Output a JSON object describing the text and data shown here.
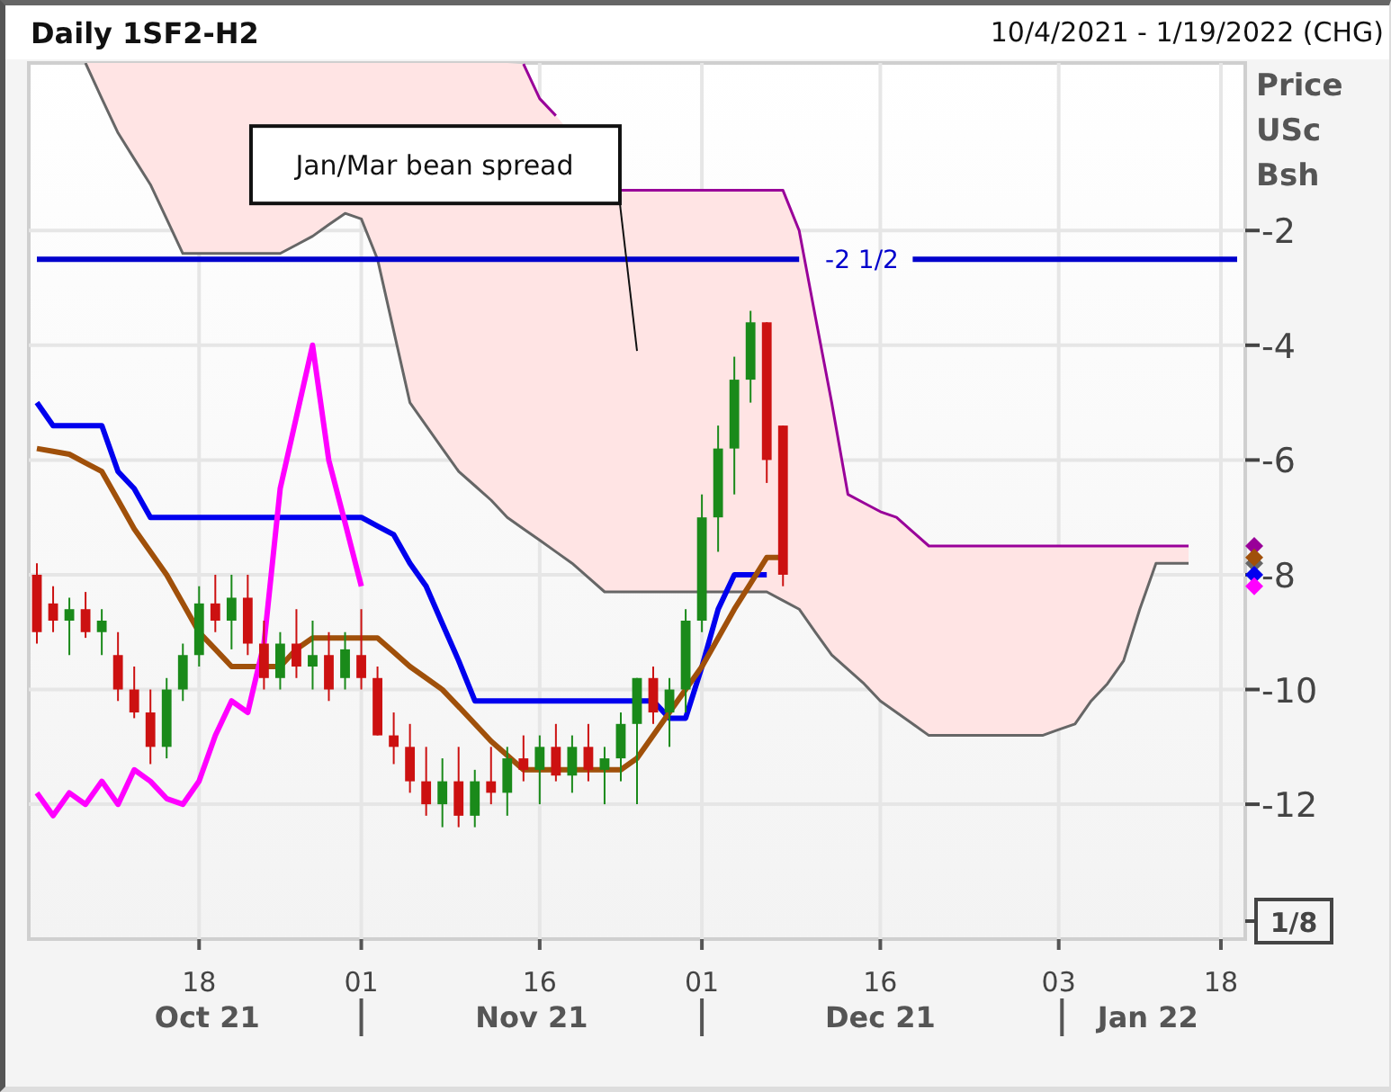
{
  "header": {
    "title": "Daily 1SF2-H2",
    "date_range": "10/4/2021 - 1/19/2022 (CHG)"
  },
  "price_scale": {
    "title_lines": [
      "Price",
      "USc",
      "Bsh"
    ],
    "fraction": "1/8"
  },
  "month_axis": [
    {
      "label": "Oct 21"
    },
    {
      "label": "Nov 21"
    },
    {
      "label": "Dec 21"
    },
    {
      "label": "Jan 22"
    }
  ],
  "chart": {
    "chart_data": {
      "type": "line",
      "ylim": [
        -14.35,
        0.92
      ],
      "grid": true,
      "yticks": [
        -2,
        -4,
        -6,
        -8,
        -10,
        -12
      ],
      "categories": [
        null,
        null,
        null,
        null,
        null,
        null,
        null,
        null,
        null,
        null,
        "18",
        null,
        null,
        null,
        null,
        null,
        null,
        null,
        null,
        null,
        "01",
        null,
        null,
        null,
        null,
        null,
        null,
        null,
        null,
        null,
        null,
        "16",
        null,
        null,
        null,
        null,
        null,
        null,
        null,
        null,
        null,
        "01",
        null,
        null,
        null,
        null,
        null,
        null,
        null,
        null,
        null,
        null,
        "16",
        null,
        null,
        null,
        null,
        null,
        null,
        null,
        null,
        null,
        null,
        "03",
        null,
        null,
        null,
        null,
        null,
        null,
        null,
        null,
        null,
        "18",
        null
      ],
      "series": [
        {
          "color": "#990099",
          "values": [
            null,
            null,
            null,
            null,
            null,
            null,
            null,
            null,
            null,
            null,
            null,
            null,
            null,
            null,
            null,
            null,
            null,
            null,
            null,
            null,
            null,
            null,
            null,
            null,
            null,
            null,
            null,
            null,
            null,
            null,
            0.9,
            0.3,
            0.0,
            null,
            null,
            null,
            -1.3,
            -1.3,
            -1.3,
            -1.3,
            -1.3,
            -1.3,
            -1.3,
            -1.3,
            -1.3,
            -1.3,
            -1.3,
            -2.0,
            -3.5,
            -5.0,
            -6.6,
            -6.75,
            -6.9,
            -7.0,
            -7.25,
            -7.5,
            -7.5,
            -7.5,
            -7.5,
            -7.5,
            -7.5,
            -7.5,
            -7.5,
            -7.5,
            -7.5,
            -7.5,
            -7.5,
            -7.5,
            -7.5,
            -7.5,
            -7.5,
            -7.5,
            null,
            null,
            null
          ]
        },
        {
          "color": "#666666",
          "values": [
            null,
            null,
            null,
            0.92,
            0.3,
            -0.3,
            -0.75,
            -1.2,
            -1.8,
            -2.4,
            -2.4,
            -2.4,
            -2.4,
            -2.4,
            -2.4,
            -2.4,
            -2.25,
            -2.1,
            -1.9,
            -1.7,
            -1.8,
            -2.5,
            -3.75,
            -5.0,
            -5.4,
            -5.8,
            -6.2,
            -6.45,
            -6.7,
            -7.0,
            -7.2,
            -7.4,
            -7.6,
            -7.8,
            -8.05,
            -8.3,
            -8.3,
            -8.3,
            -8.3,
            -8.3,
            -8.3,
            -8.3,
            -8.3,
            -8.3,
            -8.3,
            -8.3,
            -8.45,
            -8.6,
            -9.0,
            -9.4,
            -9.65,
            -9.9,
            -10.2,
            -10.4,
            -10.6,
            -10.8,
            -10.8,
            -10.8,
            -10.8,
            -10.8,
            -10.8,
            -10.8,
            -10.8,
            -10.7,
            -10.6,
            -10.2,
            -9.9,
            -9.5,
            -8.6,
            -7.8,
            -7.8,
            -7.8,
            null,
            null,
            null
          ]
        },
        {
          "color": "#0000ee",
          "values": [
            -5.0,
            -5.4,
            -5.4,
            -5.4,
            -5.4,
            -6.2,
            -6.5,
            -7.0,
            -7.0,
            -7.0,
            -7.0,
            -7.0,
            -7.0,
            -7.0,
            -7.0,
            -7.0,
            -7.0,
            -7.0,
            -7.0,
            -7.0,
            -7.0,
            -7.15,
            -7.3,
            -7.8,
            -8.2,
            -8.85,
            -9.5,
            -10.2,
            -10.2,
            -10.2,
            -10.2,
            -10.2,
            -10.2,
            -10.2,
            -10.2,
            -10.2,
            -10.2,
            -10.2,
            -10.2,
            -10.5,
            -10.5,
            -9.6,
            -8.6,
            -8.0,
            -8.0,
            -8.0,
            null,
            null,
            null,
            null,
            null,
            null,
            null,
            null,
            null,
            null,
            null,
            null,
            null,
            null,
            null,
            null,
            null,
            null,
            null,
            null,
            null,
            null,
            null,
            null,
            null,
            null,
            null,
            null,
            null
          ]
        },
        {
          "color": "#a0500a",
          "values": [
            -5.8,
            -5.85,
            -5.9,
            -6.05,
            -6.2,
            -6.7,
            -7.2,
            -7.6,
            -8.0,
            -8.5,
            -9.0,
            -9.3,
            -9.6,
            -9.6,
            -9.6,
            -9.6,
            -9.3,
            -9.1,
            -9.1,
            -9.1,
            -9.1,
            -9.1,
            -9.35,
            -9.6,
            -9.8,
            -10.0,
            -10.3,
            -10.6,
            -10.9,
            -11.15,
            -11.4,
            -11.4,
            -11.4,
            -11.4,
            -11.4,
            -11.4,
            -11.4,
            -11.2,
            -10.8,
            -10.4,
            -10.0,
            -9.6,
            -9.1,
            -8.6,
            -8.15,
            -7.7,
            -7.7,
            null,
            null,
            null,
            null,
            null,
            null,
            null,
            null,
            null,
            null,
            null,
            null,
            null,
            null,
            null,
            null,
            null,
            null,
            null,
            null,
            null,
            null,
            null,
            null,
            null,
            null,
            null,
            null
          ]
        },
        {
          "color": "#ff00ff",
          "values": [
            -11.8,
            -12.2,
            -11.8,
            -12.0,
            -11.6,
            -12.0,
            -11.4,
            -11.6,
            -11.9,
            -12.0,
            -11.6,
            -10.8,
            -10.2,
            -10.4,
            -9.2,
            -6.5,
            -5.25,
            -4.0,
            -6.0,
            -7.1,
            -8.2,
            null,
            null,
            null,
            null,
            null,
            null,
            null,
            null,
            null,
            null,
            null,
            null,
            null,
            null,
            null,
            null,
            null,
            null,
            null,
            null,
            null,
            null,
            null,
            null,
            null,
            null,
            null,
            null,
            null,
            null,
            null,
            null,
            null,
            null,
            null,
            null,
            null,
            null,
            null,
            null,
            null,
            null,
            null,
            null,
            null,
            null,
            null,
            null,
            null,
            null,
            null,
            null,
            null,
            null
          ]
        },
        {
          "name": "-2 1/2",
          "color": "#0000cc",
          "values": [
            -2.5,
            -2.5,
            -2.5,
            -2.5,
            -2.5,
            -2.5,
            -2.5,
            -2.5,
            -2.5,
            -2.5,
            -2.5,
            -2.5,
            -2.5,
            -2.5,
            -2.5,
            -2.5,
            -2.5,
            -2.5,
            -2.5,
            -2.5,
            -2.5,
            -2.5,
            -2.5,
            -2.5,
            -2.5,
            -2.5,
            -2.5,
            -2.5,
            -2.5,
            -2.5,
            -2.5,
            -2.5,
            -2.5,
            -2.5,
            -2.5,
            -2.5,
            -2.5,
            -2.5,
            -2.5,
            -2.5,
            -2.5,
            -2.5,
            -2.5,
            -2.5,
            -2.5,
            -2.5,
            -2.5,
            -2.5,
            null,
            null,
            null,
            null,
            null,
            null,
            -2.5,
            -2.5,
            -2.5,
            -2.5,
            -2.5,
            -2.5,
            -2.5,
            -2.5,
            -2.5,
            -2.5,
            -2.5,
            -2.5,
            -2.5,
            -2.5,
            -2.5,
            -2.5,
            -2.5,
            -2.5,
            -2.5,
            -2.5,
            -2.5
          ]
        }
      ],
      "annotations": [
        "Jan/Mar bean spread"
      ]
    }
  },
  "candles": {
    "chart_data": {
      "type": "candlestick",
      "ylim": [
        -14.35,
        0.92
      ],
      "ohlc": [
        [
          -8.0,
          -7.8,
          -9.2,
          -9.0
        ],
        [
          -8.5,
          -8.2,
          -9.0,
          -8.8
        ],
        [
          -8.8,
          -8.4,
          -9.4,
          -8.6
        ],
        [
          -8.6,
          -8.3,
          -9.1,
          -9.0
        ],
        [
          -9.0,
          -8.6,
          -9.4,
          -8.8
        ],
        [
          -9.4,
          -9.0,
          -10.2,
          -10.0
        ],
        [
          -10.0,
          -9.6,
          -10.5,
          -10.4
        ],
        [
          -10.4,
          -10.0,
          -11.3,
          -11.0
        ],
        [
          -11.0,
          -9.8,
          -11.2,
          -10.0
        ],
        [
          -10.0,
          -9.2,
          -10.2,
          -9.4
        ],
        [
          -9.4,
          -8.2,
          -9.6,
          -8.5
        ],
        [
          -8.5,
          -8.0,
          -9.0,
          -8.8
        ],
        [
          -8.8,
          -8.0,
          -9.3,
          -8.4
        ],
        [
          -8.4,
          -8.0,
          -9.4,
          -9.2
        ],
        [
          -9.2,
          -8.8,
          -10.0,
          -9.8
        ],
        [
          -9.8,
          -9.0,
          -10.0,
          -9.2
        ],
        [
          -9.2,
          -8.6,
          -9.8,
          -9.6
        ],
        [
          -9.6,
          -8.8,
          -10.0,
          -9.4
        ],
        [
          -9.4,
          -9.0,
          -10.2,
          -10.0
        ],
        [
          -9.8,
          -9.0,
          -10.0,
          -9.3
        ],
        [
          -9.4,
          -8.6,
          -10.0,
          -9.8
        ],
        [
          -9.8,
          -9.6,
          -10.8,
          -10.8
        ],
        [
          -10.8,
          -10.4,
          -11.3,
          -11.0
        ],
        [
          -11.0,
          -10.6,
          -11.8,
          -11.6
        ],
        [
          -11.6,
          -11.0,
          -12.2,
          -12.0
        ],
        [
          -12.0,
          -11.2,
          -12.4,
          -11.6
        ],
        [
          -11.6,
          -11.0,
          -12.4,
          -12.2
        ],
        [
          -12.2,
          -11.4,
          -12.4,
          -11.6
        ],
        [
          -11.6,
          -11.0,
          -12.0,
          -11.8
        ],
        [
          -11.8,
          -11.0,
          -12.2,
          -11.2
        ],
        [
          -11.2,
          -10.8,
          -11.6,
          -11.4
        ],
        [
          -11.4,
          -10.8,
          -12.0,
          -11.0
        ],
        [
          -11.0,
          -10.6,
          -11.6,
          -11.5
        ],
        [
          -11.5,
          -10.8,
          -11.8,
          -11.0
        ],
        [
          -11.0,
          -10.6,
          -11.6,
          -11.4
        ],
        [
          -11.4,
          -11.0,
          -12.0,
          -11.2
        ],
        [
          -11.2,
          -10.4,
          -11.6,
          -10.6
        ],
        [
          -10.6,
          -9.8,
          -12.0,
          -9.8
        ],
        [
          -9.8,
          -9.6,
          -10.6,
          -10.4
        ],
        [
          -10.4,
          -9.8,
          -11.0,
          -10.0
        ],
        [
          -10.0,
          -8.6,
          -10.4,
          -8.8
        ],
        [
          -8.8,
          -6.6,
          -9.0,
          -7.0
        ],
        [
          -7.0,
          -5.4,
          -7.6,
          -5.8
        ],
        [
          -5.8,
          -4.2,
          -6.6,
          -4.6
        ],
        [
          -4.6,
          -3.4,
          -5.0,
          -3.6
        ],
        [
          -3.6,
          -3.6,
          -6.4,
          -6.0
        ],
        [
          -5.4,
          -5.4,
          -8.2,
          -8.0
        ]
      ]
    }
  }
}
